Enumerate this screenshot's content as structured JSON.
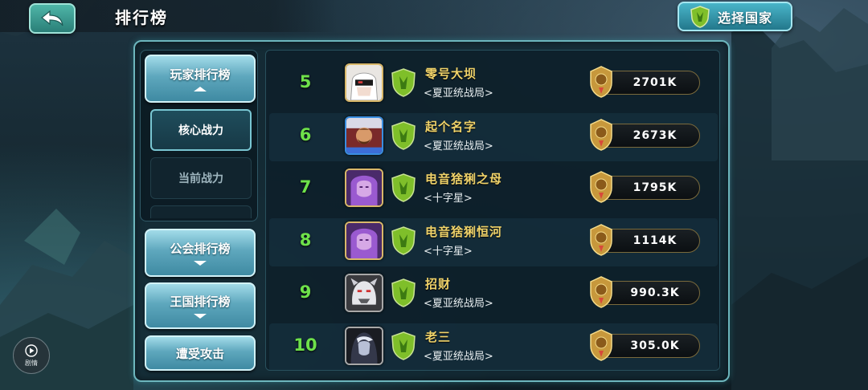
{
  "header": {
    "title": "排行榜",
    "country_button_label": "选择国家"
  },
  "menu": {
    "player_ranking": "玩家排行榜",
    "sub_items": [
      {
        "label": "核心战力",
        "active": true
      },
      {
        "label": "当前战力",
        "active": false
      }
    ],
    "guild_ranking": "公会排行榜",
    "kingdom_ranking": "王国排行榜",
    "attacked": "遭受攻击"
  },
  "rows": [
    {
      "rank": "5",
      "name": "零号大坝",
      "guild": "<夏亚统战局>",
      "power": "2701K",
      "avatar": "white-hair-masked-avatar"
    },
    {
      "rank": "6",
      "name": "起个名字",
      "guild": "<夏亚统战局>",
      "power": "2673K",
      "avatar": "bearded-warrior-avatar"
    },
    {
      "rank": "7",
      "name": "电音猞猁之母",
      "guild": "<十字星>",
      "power": "1795K",
      "avatar": "purple-hair-sorceress-avatar"
    },
    {
      "rank": "8",
      "name": "电音猞猁恒河",
      "guild": "<十字星>",
      "power": "1114K",
      "avatar": "purple-hair-sorceress-avatar"
    },
    {
      "rank": "9",
      "name": "招财",
      "guild": "<夏亚统战局>",
      "power": "990.3K",
      "avatar": "white-beast-avatar"
    },
    {
      "rank": "10",
      "name": "老三",
      "guild": "<夏亚统战局>",
      "power": "305.0K",
      "avatar": "dark-hooded-avatar"
    }
  ],
  "replay": {
    "label": "剧情"
  },
  "colors": {
    "rank_green": "#6ee14a",
    "name_gold": "#f0d36a",
    "frame_teal": "#6db6bd",
    "button_teal": "#3f8aa2"
  }
}
